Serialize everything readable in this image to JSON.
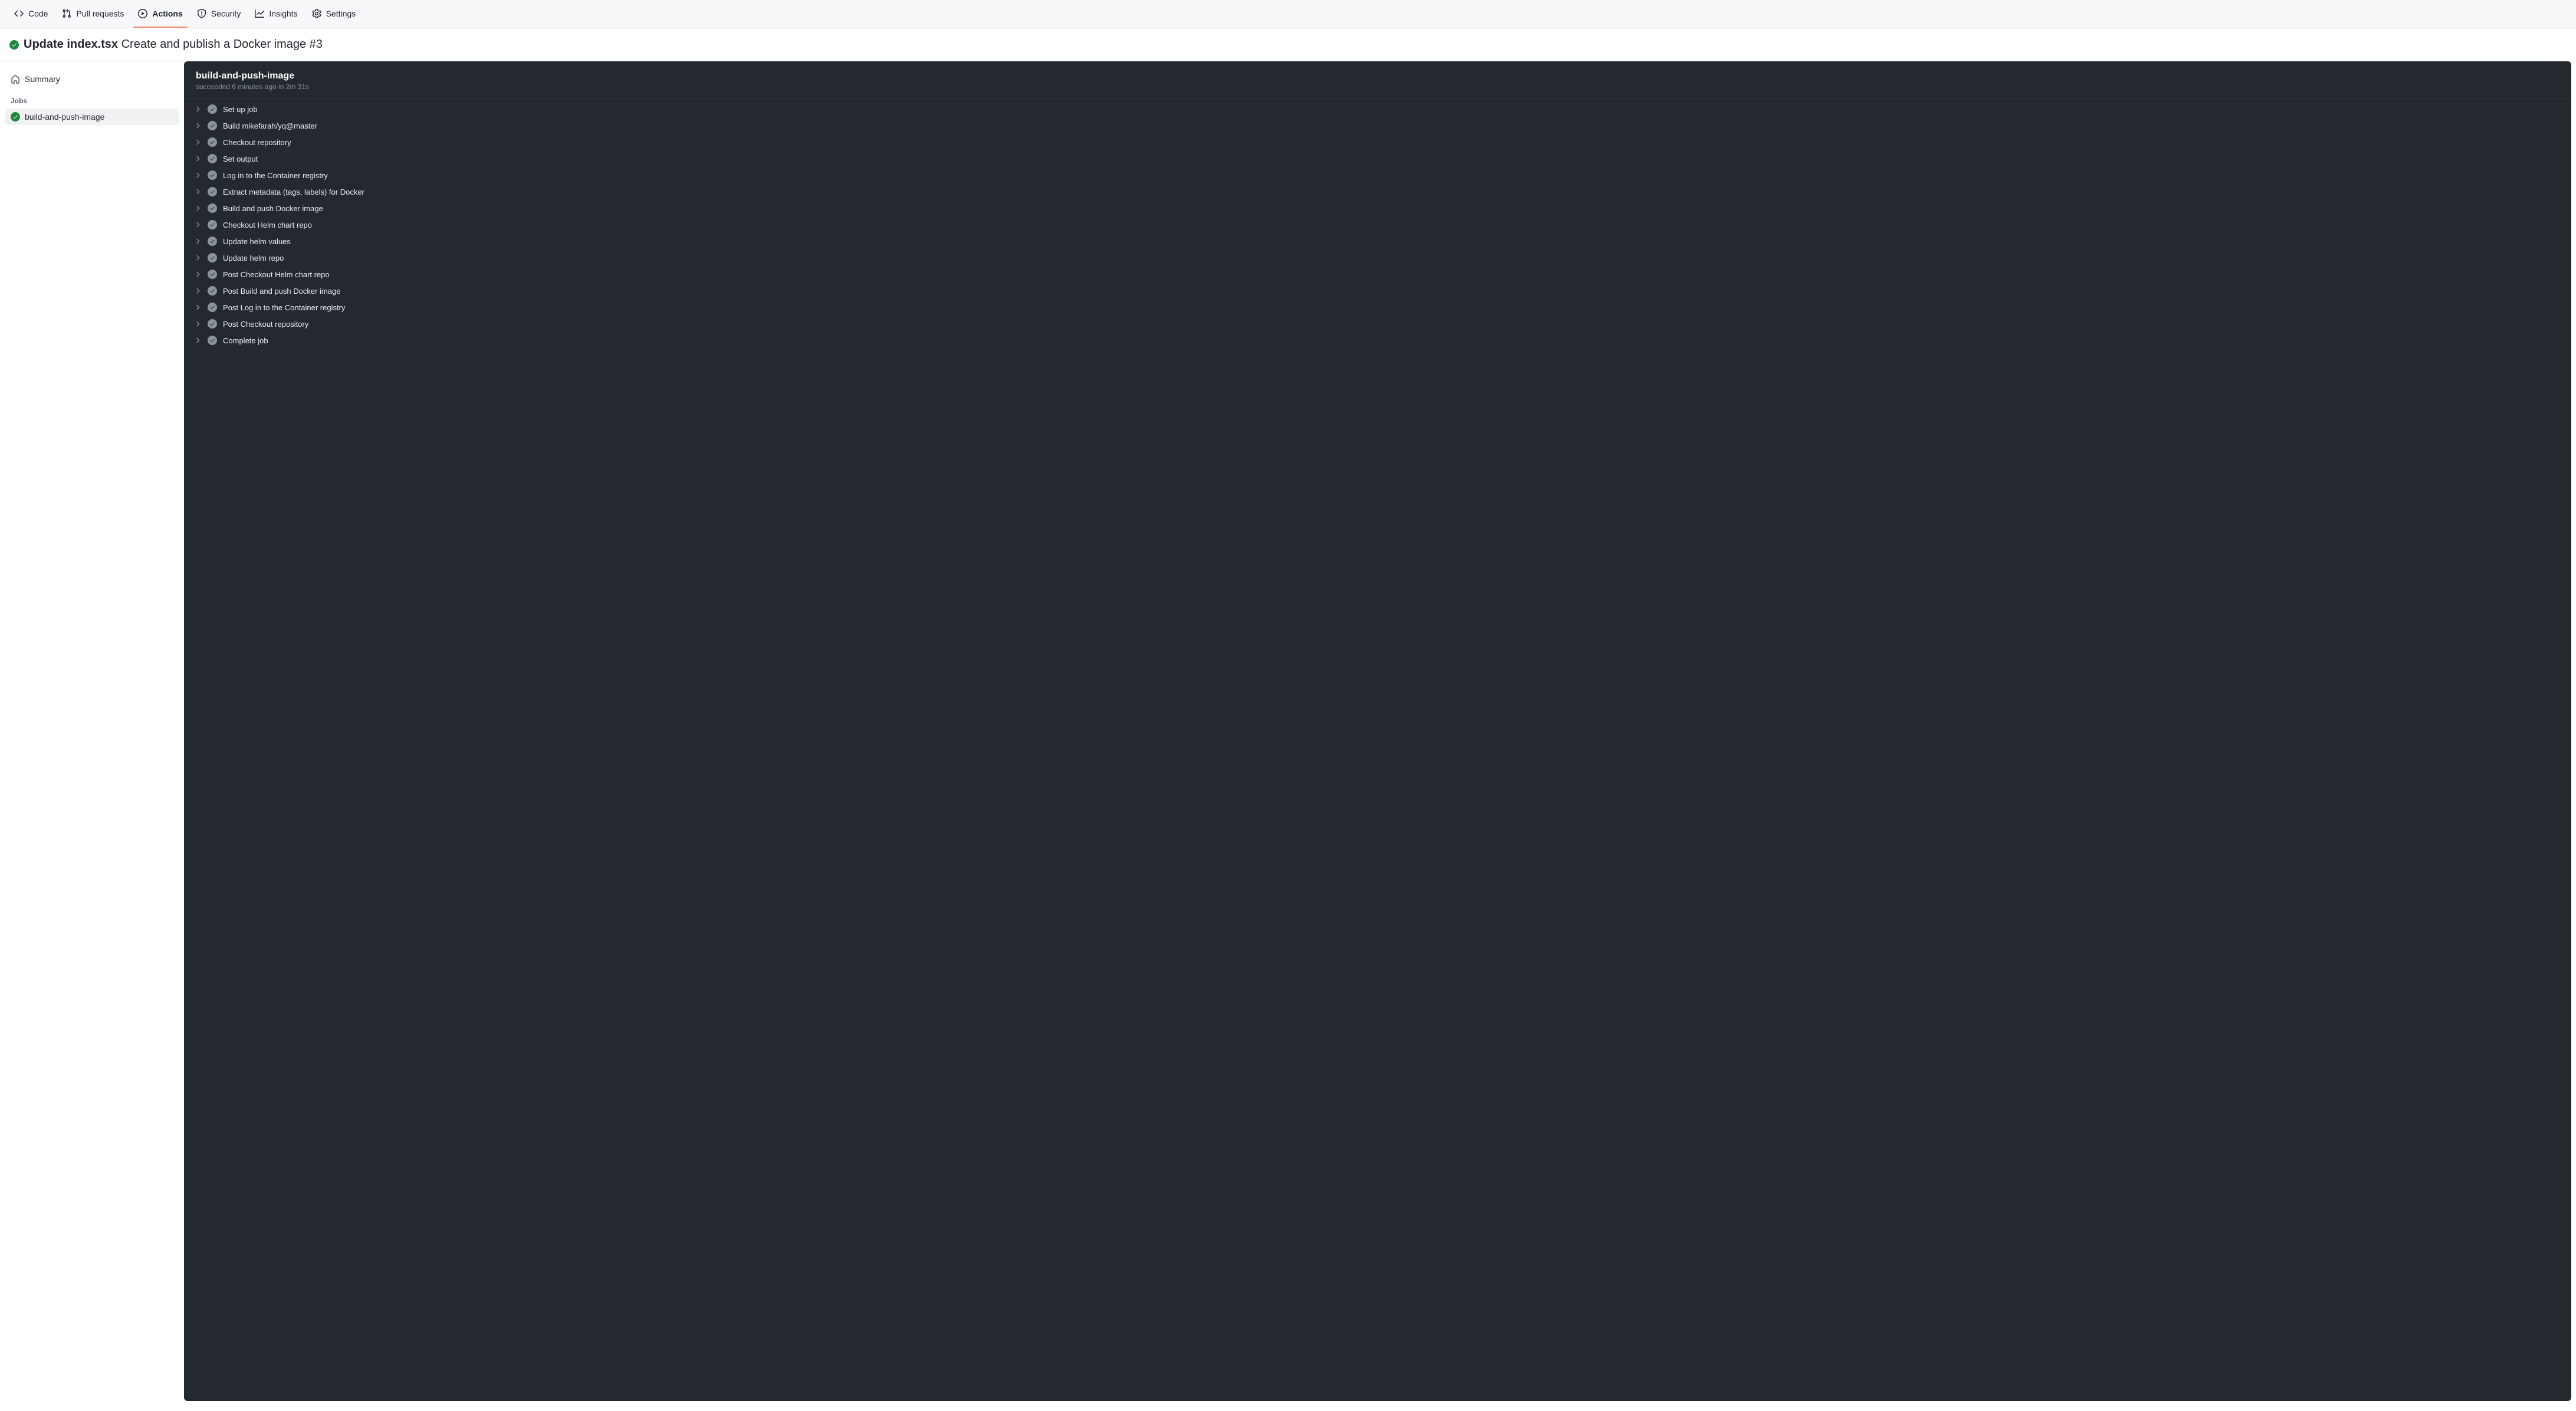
{
  "nav": {
    "items": [
      {
        "label": "Code"
      },
      {
        "label": "Pull requests"
      },
      {
        "label": "Actions"
      },
      {
        "label": "Security"
      },
      {
        "label": "Insights"
      },
      {
        "label": "Settings"
      }
    ]
  },
  "run": {
    "title_strong": "Update index.tsx",
    "title_rest": "Create and publish a Docker image #3"
  },
  "sidebar": {
    "summary_label": "Summary",
    "jobs_heading": "Jobs",
    "jobs": [
      {
        "label": "build-and-push-image"
      }
    ]
  },
  "job": {
    "title": "build-and-push-image",
    "subtitle": "succeeded 6 minutes ago in 2m 31s",
    "steps": [
      {
        "name": "Set up job"
      },
      {
        "name": "Build mikefarah/yq@master"
      },
      {
        "name": "Checkout repository"
      },
      {
        "name": "Set output"
      },
      {
        "name": "Log in to the Container registry"
      },
      {
        "name": "Extract metadata (tags, labels) for Docker"
      },
      {
        "name": "Build and push Docker image"
      },
      {
        "name": "Checkout Helm chart repo"
      },
      {
        "name": "Update helm values"
      },
      {
        "name": "Update helm repo"
      },
      {
        "name": "Post Checkout Helm chart repo"
      },
      {
        "name": "Post Build and push Docker image"
      },
      {
        "name": "Post Log in to the Container registry"
      },
      {
        "name": "Post Checkout repository"
      },
      {
        "name": "Complete job"
      }
    ]
  }
}
